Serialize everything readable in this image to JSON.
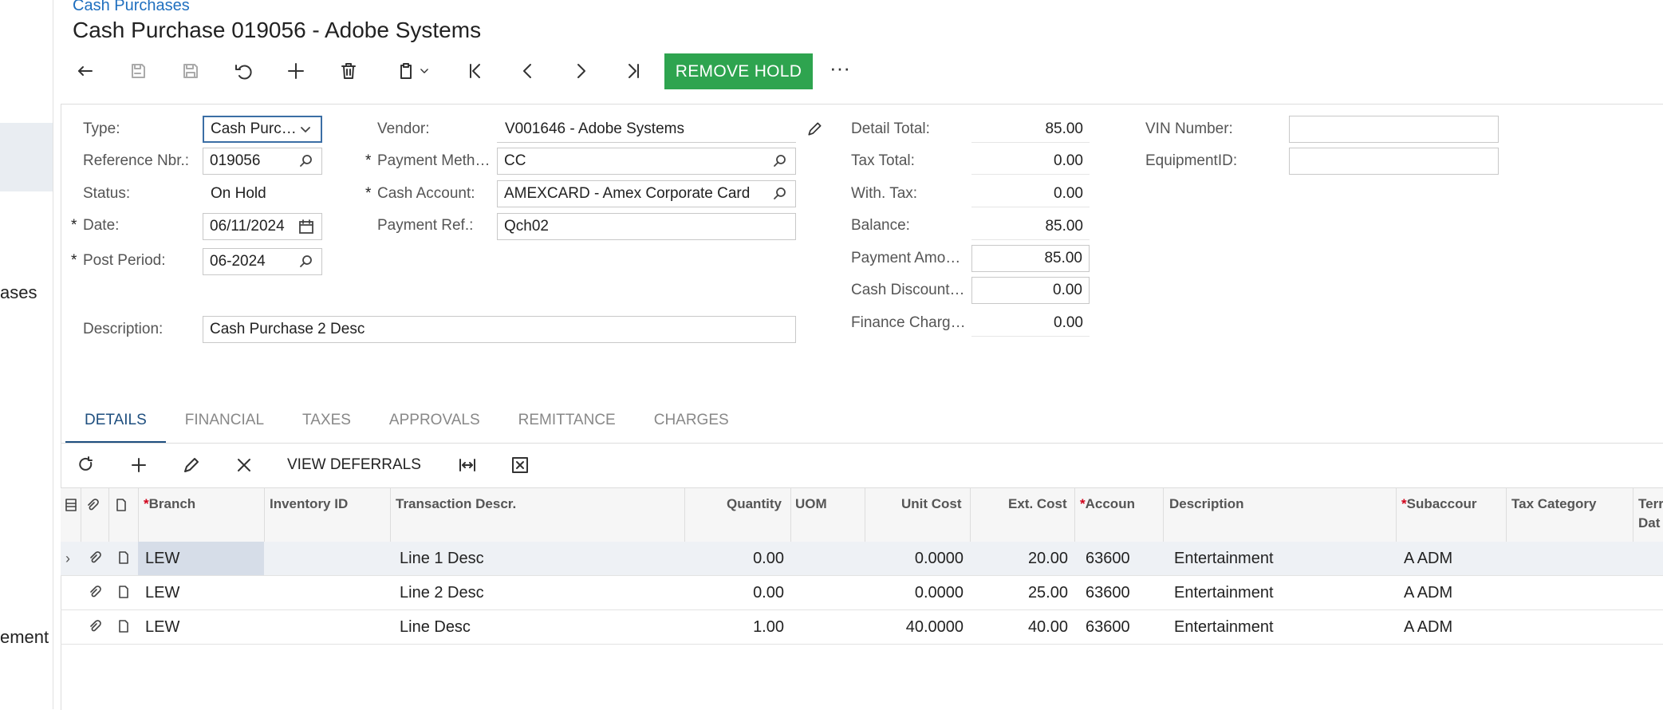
{
  "left_nav": {
    "label_1": "ases",
    "label_2": "ement"
  },
  "breadcrumb": "Cash Purchases",
  "page_title": "Cash Purchase 019056 - Adobe Systems",
  "toolbar": {
    "remove_hold": "REMOVE HOLD",
    "more": "···"
  },
  "form": {
    "type_label": "Type:",
    "type_value": "Cash Purc…",
    "ref_label": "Reference Nbr.:",
    "ref_value": "019056",
    "status_label": "Status:",
    "status_value": "On Hold",
    "date_label": "Date:",
    "date_value": "06/11/2024",
    "period_label": "Post Period:",
    "period_value": "06-2024",
    "desc_label": "Description:",
    "desc_value": "Cash Purchase 2 Desc",
    "vendor_label": "Vendor:",
    "vendor_value": "V001646 - Adobe Systems",
    "paymeth_label": "Payment Meth…",
    "paymeth_value": "CC",
    "cashacct_label": "Cash Account:",
    "cashacct_value": "AMEXCARD - Amex Corporate Card",
    "payref_label": "Payment Ref.:",
    "payref_value": "Qch02",
    "detail_total_label": "Detail Total:",
    "detail_total_value": "85.00",
    "tax_total_label": "Tax Total:",
    "tax_total_value": "0.00",
    "with_tax_label": "With. Tax:",
    "with_tax_value": "0.00",
    "balance_label": "Balance:",
    "balance_value": "85.00",
    "payment_amt_label": "Payment Amo…",
    "payment_amt_value": "85.00",
    "cash_discount_label": "Cash Discount…",
    "cash_discount_value": "0.00",
    "finance_charge_label": "Finance Charg…",
    "finance_charge_value": "0.00",
    "vin_label": "VIN Number:",
    "vin_value": "",
    "equipment_label": "EquipmentID:",
    "equipment_value": ""
  },
  "tabs": [
    "DETAILS",
    "FINANCIAL",
    "TAXES",
    "APPROVALS",
    "REMITTANCE",
    "CHARGES"
  ],
  "grid_toolbar": {
    "view_deferrals": "VIEW DEFERRALS"
  },
  "grid": {
    "headers": {
      "branch": "Branch",
      "inventory": "Inventory ID",
      "trandesc": "Transaction Descr.",
      "quantity": "Quantity",
      "uom": "UOM",
      "unitcost": "Unit Cost",
      "extcost": "Ext. Cost",
      "account": "Accoun",
      "description": "Description",
      "subaccount": "Subaccour",
      "taxcat": "Tax Category",
      "term1": "Terr",
      "term2": "Dat"
    },
    "rows": [
      {
        "branch": "LEW",
        "trandesc": "Line 1 Desc",
        "quantity": "0.00",
        "unitcost": "0.0000",
        "extcost": "20.00",
        "account": "63600",
        "description": "Entertainment",
        "subaccount": "A ADM"
      },
      {
        "branch": "LEW",
        "trandesc": "Line 2 Desc",
        "quantity": "0.00",
        "unitcost": "0.0000",
        "extcost": "25.00",
        "account": "63600",
        "description": "Entertainment",
        "subaccount": "A ADM"
      },
      {
        "branch": "LEW",
        "trandesc": "Line Desc",
        "quantity": "1.00",
        "unitcost": "40.0000",
        "extcost": "40.00",
        "account": "63600",
        "description": "Entertainment",
        "subaccount": "A ADM"
      }
    ]
  }
}
